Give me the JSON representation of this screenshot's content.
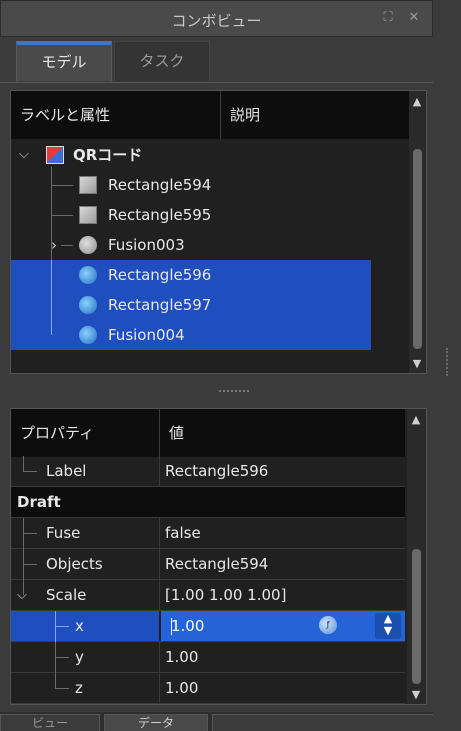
{
  "window": {
    "title": "コンボビュー"
  },
  "tabs": [
    {
      "label": "モデル",
      "active": true
    },
    {
      "label": "タスク",
      "active": false
    }
  ],
  "tree": {
    "headers": [
      "ラベルと属性",
      "説明"
    ],
    "items": [
      {
        "label": "QRコード",
        "icon": "group-icon",
        "selected": false,
        "expander": "expanded"
      },
      {
        "label": "Rectangle594",
        "icon": "cube-icon",
        "selected": false,
        "expander": ""
      },
      {
        "label": "Rectangle595",
        "icon": "cube-icon",
        "selected": false,
        "expander": ""
      },
      {
        "label": "Fusion003",
        "icon": "fusion-icon",
        "selected": false,
        "expander": "collapsed"
      },
      {
        "label": "Rectangle596",
        "icon": "draft-icon",
        "selected": true,
        "expander": ""
      },
      {
        "label": "Rectangle597",
        "icon": "draft-icon",
        "selected": true,
        "expander": ""
      },
      {
        "label": "Fusion004",
        "icon": "draft-icon",
        "selected": true,
        "expander": ""
      }
    ]
  },
  "properties": {
    "headers": [
      "プロパティ",
      "値"
    ],
    "rows": [
      {
        "key": "Label",
        "value": "Rectangle596"
      },
      {
        "group": "Draft"
      },
      {
        "key": "Fuse",
        "value": "false"
      },
      {
        "key": "Objects",
        "value": "Rectangle594"
      },
      {
        "key": "Scale",
        "value": "[1.00 1.00 1.00]"
      },
      {
        "key": "x",
        "value": "1.00",
        "editing": true
      },
      {
        "key": "y",
        "value": "1.00"
      },
      {
        "key": "z",
        "value": "1.00"
      }
    ]
  },
  "bottom_tabs": [
    "ビュー",
    "データ"
  ],
  "colors": {
    "selection": "#1f4fbf",
    "accent": "#3a78d8",
    "background": "#202020"
  }
}
